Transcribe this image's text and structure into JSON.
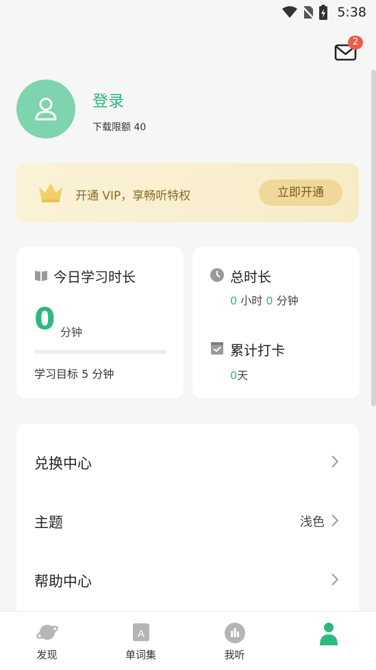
{
  "status_bar": {
    "time": "5:38"
  },
  "mail": {
    "badge_count": "2",
    "icon": "mail-icon"
  },
  "profile": {
    "login_label": "登录",
    "download_quota": "下载限额 40"
  },
  "vip": {
    "text": "开通 VIP，享畅听特权",
    "button_label": "立即开通"
  },
  "today": {
    "title": "今日学习时长",
    "minutes": "0",
    "unit": "分钟",
    "progress": 0,
    "goal_text": "学习目标 5 分钟"
  },
  "total": {
    "title": "总时长",
    "hours": "0",
    "hours_unit": "小时",
    "minutes": "0",
    "minutes_unit": "分钟"
  },
  "checkin": {
    "title": "累计打卡",
    "days": "0",
    "days_unit": "天"
  },
  "menu": [
    {
      "label": "兑换中心",
      "value": ""
    },
    {
      "label": "主题",
      "value": "浅色"
    },
    {
      "label": "帮助中心",
      "value": ""
    }
  ],
  "nav": [
    {
      "label": "发现",
      "icon": "planet-icon"
    },
    {
      "label": "单词集",
      "icon": "word-book-icon"
    },
    {
      "label": "我听",
      "icon": "audio-bars-icon"
    },
    {
      "label": "",
      "icon": "profile-icon"
    }
  ],
  "colors": {
    "accent": "#2eb87d",
    "avatar": "#7ed4ad",
    "vip_bg": "#faf2d6",
    "vip_button": "#efd89a"
  }
}
